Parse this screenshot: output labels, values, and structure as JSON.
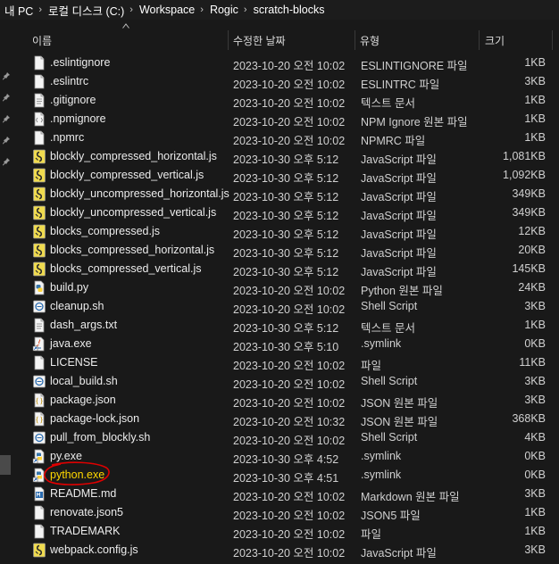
{
  "breadcrumb": [
    "내 PC",
    "로컬 디스크 (C:)",
    "Workspace",
    "Rogic",
    "scratch-blocks"
  ],
  "columns": {
    "name": "이름",
    "date": "수정한 날짜",
    "type": "유형",
    "size": "크기"
  },
  "files": [
    {
      "name": ".eslintignore",
      "date": "2023-10-20 오전 10:02",
      "type": "ESLINTIGNORE 파일",
      "size": "1KB",
      "icon": "blank-file-icon"
    },
    {
      "name": ".eslintrc",
      "date": "2023-10-20 오전 10:02",
      "type": "ESLINTRC 파일",
      "size": "3KB",
      "icon": "blank-file-icon"
    },
    {
      "name": ".gitignore",
      "date": "2023-10-20 오전 10:02",
      "type": "텍스트 문서",
      "size": "1KB",
      "icon": "text-file-icon"
    },
    {
      "name": ".npmignore",
      "date": "2023-10-20 오전 10:02",
      "type": "NPM Ignore 원본 파일",
      "size": "1KB",
      "icon": "source-file-icon"
    },
    {
      "name": ".npmrc",
      "date": "2023-10-20 오전 10:02",
      "type": "NPMRC 파일",
      "size": "1KB",
      "icon": "blank-file-icon"
    },
    {
      "name": "blockly_compressed_horizontal.js",
      "date": "2023-10-30 오후 5:12",
      "type": "JavaScript 파일",
      "size": "1,081KB",
      "icon": "javascript-file-icon"
    },
    {
      "name": "blockly_compressed_vertical.js",
      "date": "2023-10-30 오후 5:12",
      "type": "JavaScript 파일",
      "size": "1,092KB",
      "icon": "javascript-file-icon"
    },
    {
      "name": "blockly_uncompressed_horizontal.js",
      "date": "2023-10-30 오후 5:12",
      "type": "JavaScript 파일",
      "size": "349KB",
      "icon": "javascript-file-icon"
    },
    {
      "name": "blockly_uncompressed_vertical.js",
      "date": "2023-10-30 오후 5:12",
      "type": "JavaScript 파일",
      "size": "349KB",
      "icon": "javascript-file-icon"
    },
    {
      "name": "blocks_compressed.js",
      "date": "2023-10-30 오후 5:12",
      "type": "JavaScript 파일",
      "size": "12KB",
      "icon": "javascript-file-icon"
    },
    {
      "name": "blocks_compressed_horizontal.js",
      "date": "2023-10-30 오후 5:12",
      "type": "JavaScript 파일",
      "size": "20KB",
      "icon": "javascript-file-icon"
    },
    {
      "name": "blocks_compressed_vertical.js",
      "date": "2023-10-30 오후 5:12",
      "type": "JavaScript 파일",
      "size": "145KB",
      "icon": "javascript-file-icon"
    },
    {
      "name": "build.py",
      "date": "2023-10-20 오전 10:02",
      "type": "Python 원본 파일",
      "size": "24KB",
      "icon": "python-file-icon"
    },
    {
      "name": "cleanup.sh",
      "date": "2023-10-20 오전 10:02",
      "type": "Shell Script",
      "size": "3KB",
      "icon": "shell-script-icon"
    },
    {
      "name": "dash_args.txt",
      "date": "2023-10-30 오후 5:12",
      "type": "텍스트 문서",
      "size": "1KB",
      "icon": "text-file-icon"
    },
    {
      "name": "java.exe",
      "date": "2023-10-30 오후 5:10",
      "type": ".symlink",
      "size": "0KB",
      "icon": "java-shortcut-icon"
    },
    {
      "name": "LICENSE",
      "date": "2023-10-20 오전 10:02",
      "type": "파일",
      "size": "11KB",
      "icon": "blank-file-icon"
    },
    {
      "name": "local_build.sh",
      "date": "2023-10-20 오전 10:02",
      "type": "Shell Script",
      "size": "3KB",
      "icon": "shell-script-icon"
    },
    {
      "name": "package.json",
      "date": "2023-10-20 오전 10:02",
      "type": "JSON 원본 파일",
      "size": "3KB",
      "icon": "json-file-icon"
    },
    {
      "name": "package-lock.json",
      "date": "2023-10-20 오전 10:32",
      "type": "JSON 원본 파일",
      "size": "368KB",
      "icon": "json-file-icon"
    },
    {
      "name": "pull_from_blockly.sh",
      "date": "2023-10-20 오전 10:02",
      "type": "Shell Script",
      "size": "4KB",
      "icon": "shell-script-icon"
    },
    {
      "name": "py.exe",
      "date": "2023-10-30 오후 4:52",
      "type": ".symlink",
      "size": "0KB",
      "icon": "python-shortcut-icon"
    },
    {
      "name": "python.exe",
      "date": "2023-10-30 오후 4:51",
      "type": ".symlink",
      "size": "0KB",
      "icon": "python-shortcut-icon",
      "highlight": true
    },
    {
      "name": "README.md",
      "date": "2023-10-20 오전 10:02",
      "type": "Markdown 원본 파일",
      "size": "3KB",
      "icon": "markdown-file-icon"
    },
    {
      "name": "renovate.json5",
      "date": "2023-10-20 오전 10:02",
      "type": "JSON5 파일",
      "size": "1KB",
      "icon": "blank-file-icon"
    },
    {
      "name": "TRADEMARK",
      "date": "2023-10-20 오전 10:02",
      "type": "파일",
      "size": "1KB",
      "icon": "blank-file-icon"
    },
    {
      "name": "webpack.config.js",
      "date": "2023-10-20 오전 10:02",
      "type": "JavaScript 파일",
      "size": "3KB",
      "icon": "javascript-file-icon"
    }
  ],
  "colors": {
    "background": "#191919",
    "highlight_circle": "#e00000",
    "highlight_text": "#ffd800",
    "javascript_badge": "#f0db4f",
    "python_blue": "#3776ab",
    "python_yellow": "#ffd43b"
  }
}
